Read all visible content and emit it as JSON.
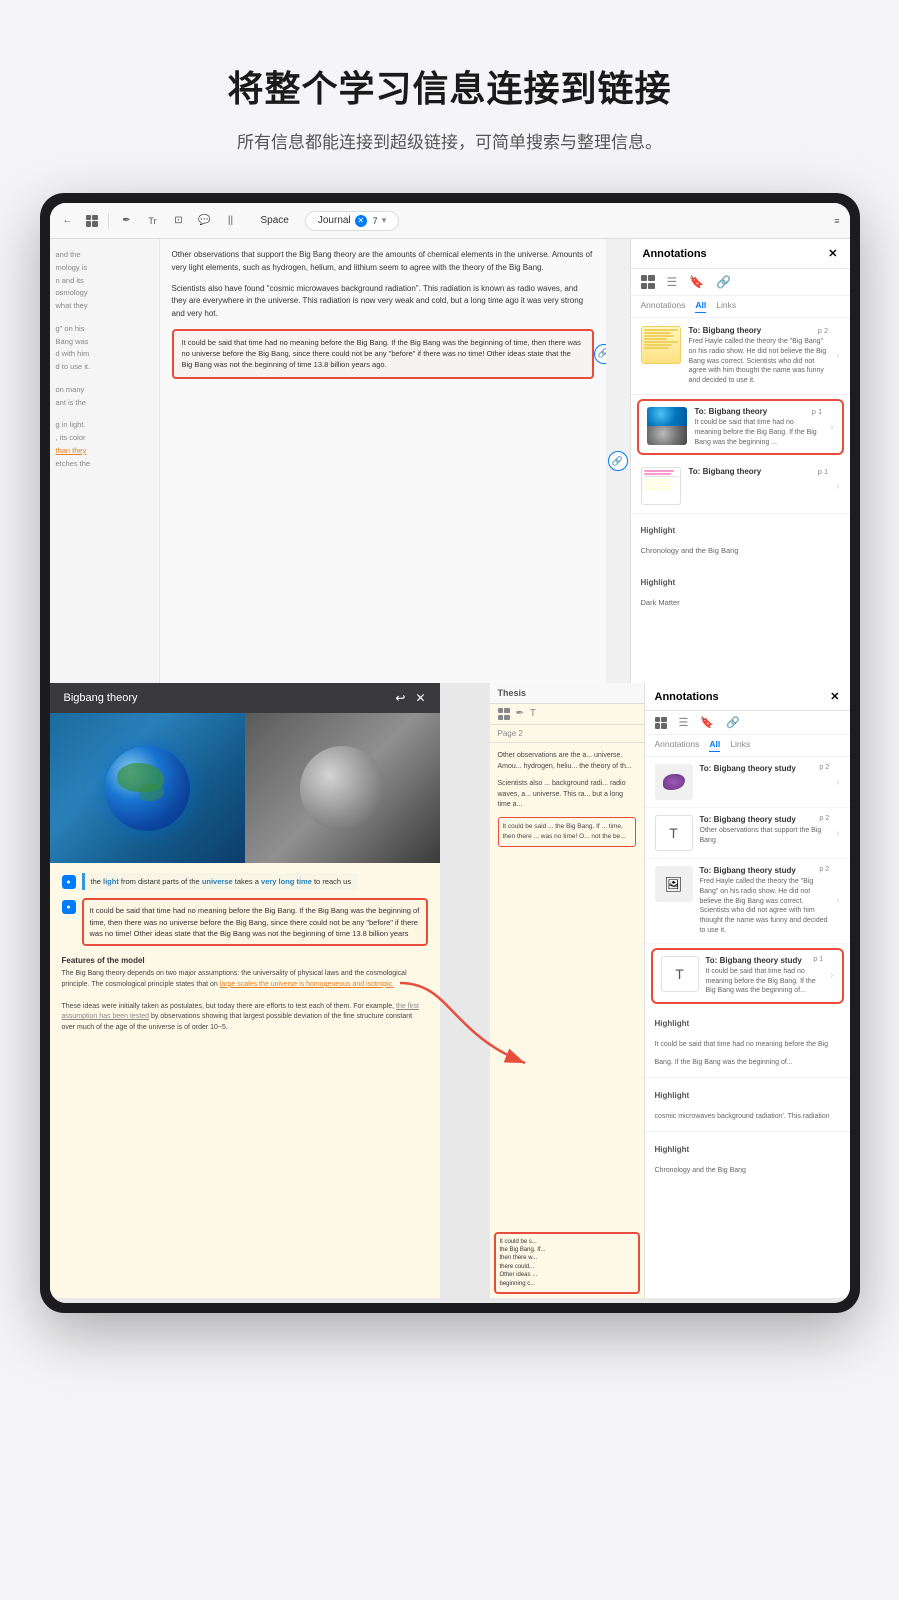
{
  "page": {
    "title": "将整个学习信息连接到链接",
    "subtitle": "所有信息都能连接到超级链接，可简单搜索与整理信息。"
  },
  "top_toolbar": {
    "back": "←",
    "grid": "⊞",
    "tab_space": "Space",
    "tab_journal": "Journal",
    "journal_count": "7",
    "annotations_title": "Annotations",
    "close": "✕"
  },
  "annotations_panel": {
    "tabs": [
      "Annotations",
      "All",
      "Links"
    ],
    "active_tab": "All",
    "items": [
      {
        "title": "To: Bigbang theory",
        "page": "p 2",
        "desc": "Fred Hayle called the theory the 'Big Bang' on his radio show. He did not believe the Big Bang was correct. Scientists who did not agree with him thought the name was funny and decided to use it.",
        "thumb_type": "highlight"
      },
      {
        "title": "To: Bigbang theory",
        "page": "p 1",
        "desc": "It could be said that time had no meaning before the Big Bang. If the Big Bang was the beginning ...",
        "thumb_type": "earth_moon",
        "highlighted": true
      },
      {
        "title": "To: Bigbang theory",
        "page": "p 1",
        "desc": "",
        "thumb_type": "text_highlight"
      },
      {
        "label": "Highlight",
        "text": "Chronology and the Big Bang"
      },
      {
        "label": "Highlight",
        "text": "Dark Matter"
      }
    ]
  },
  "bigbang_popup": {
    "title": "Bigbang theory",
    "highlight1_text": "the light from distant parts of the universe takes a very long time to reach us",
    "highlight2_text": "It could be said that time had no meaning before the Big Bang. If the Big Bang was the beginning of time, then there was no universe before the Big Bang, since there could not be any \"before\" if there was no time! Other ideas state that the Big Bang was not the beginning of time 13.8 billion years",
    "features_title": "Features of the model",
    "features_text": "The Big Bang theory depends on two major assumptions: the universality of physical laws and the cosmological principle. The cosmological principle states that on large scales the universe is homogeneous and isotropic. These ideas were initially taken as postulates, but today there are efforts to test each of them. For example, the first assumption has been tested by observations showing that largest possible deviation of the fine structure constant over much of the age of the universe is of order 10−5."
  },
  "right_window": {
    "header_label": "Thesis",
    "page_label": "Page 2",
    "annotations_title": "Annotations",
    "tabs": [
      "Annotations",
      "All",
      "Links"
    ],
    "items": [
      {
        "title": "To: Bigbang theory study",
        "page": "p 2",
        "desc": "",
        "thumb_type": "purple"
      },
      {
        "title": "To: Bigbang theory study",
        "page": "p 2",
        "desc": "Other observations that support the Big Bang",
        "thumb_type": "text"
      },
      {
        "title": "To: Bigbang theory study",
        "page": "p 2",
        "desc": "Fred Hayle called the theory the 'Big Bang' on his radio show. He did not believe the Big Bang was correct. Scientists who did not agree with him thought the name was funny and decided to use it.",
        "thumb_type": "image"
      },
      {
        "title": "To: Bigbang theory study",
        "page": "p 1",
        "desc": "It could be said that time had no meaning before the Big Bang. If the Big Bang was the beginning of...",
        "thumb_type": "text_t",
        "highlighted": true
      },
      {
        "label": "Highlight",
        "text": "It could be said that time had no meaning before the Big Bang. If the Big Bang was the beginning of..."
      },
      {
        "label": "Highlight",
        "text": "cosmic microwaves background radiation'. This radiation"
      },
      {
        "label": "Highlight",
        "text": "Chronology and the Big Bang"
      }
    ]
  },
  "main_text": {
    "left_col_lines": [
      "and the",
      "mology is",
      "n and its",
      "osmology",
      "what they",
      "",
      "g\" on his",
      "Bang was",
      "d with him",
      "d to use it.",
      "",
      "on many",
      "ant is the",
      "",
      "g in light.",
      ", its color",
      "than they",
      "etches the"
    ],
    "right_col_text": "Other observations that support the Big Bang theory are the amounts of chemical elements in the universe. Amounts of very light elements, such as hydrogen, helium, and lithium seem to agree with the theory of the Big Bang.\n\nScientists also have found \"cosmic microwaves background radiation\". This radiation is known as radio waves, and they are everywhere in the universe. This radiation is now very weak and cold, but a long time ago it was very strong and very hot.",
    "highlight_text": "It could be said that time had no meaning before the Big Bang. If the Big Bang was the beginning of time, then there was no universe before the Big Bang, since there could not be any \"before\" if there was no time! Other ideas state that the Big Bang was not the beginning of time 13.8 billion years ago."
  },
  "preview_box": {
    "text": "It could be said that time had no meaning before the Big Bang. If the Big Bang was the beginning of time, then there were..."
  }
}
